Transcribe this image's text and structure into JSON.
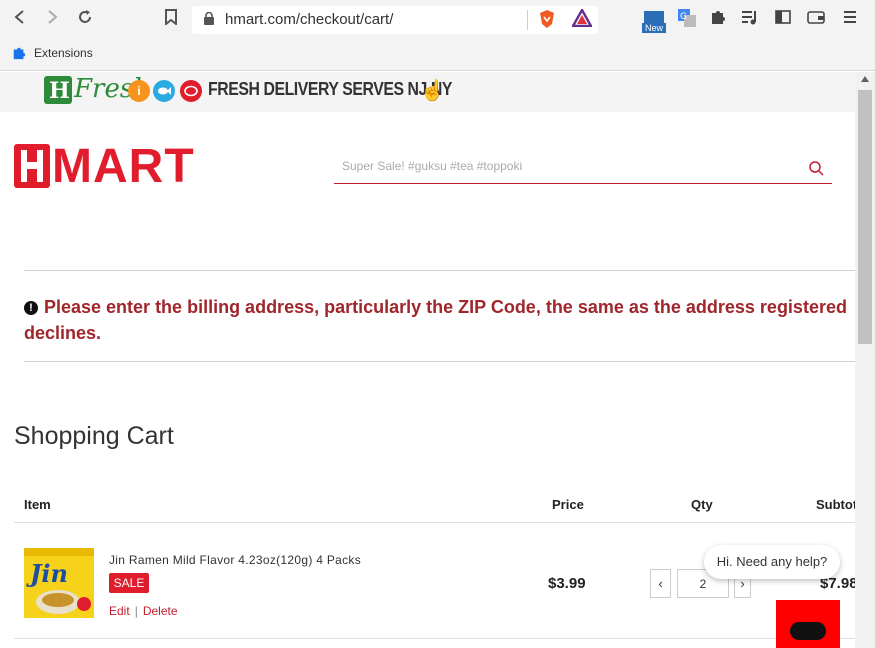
{
  "browser": {
    "url": "hmart.com/checkout/cart/",
    "new_badge": "New",
    "bookmarks": [
      "Extensions"
    ]
  },
  "promo": {
    "brand": "Fresh",
    "text": "FRESH DELIVERY SERVES NJ.NY"
  },
  "header": {
    "logo_text": "MART",
    "search_placeholder": "Super Sale! #guksu #tea #toppoki"
  },
  "notice": {
    "line1": "Please enter the billing address, particularly the ZIP Code, the same as the address registered",
    "line2": "declines."
  },
  "cart": {
    "title": "Shopping Cart",
    "columns": {
      "item": "Item",
      "price": "Price",
      "qty": "Qty",
      "subtotal": "Subtota"
    },
    "items": [
      {
        "name": "Jin Ramen Mild Flavor 4.23oz(120g) 4 Packs",
        "badge": "SALE",
        "edit": "Edit",
        "delete": "Delete",
        "price": "$3.99",
        "qty": "2",
        "subtotal": "$7.98"
      }
    ]
  },
  "chat": {
    "greeting": "Hi. Need any help?"
  },
  "colors": {
    "brand_red": "#e11c2c",
    "notice_red": "#a0262c"
  }
}
